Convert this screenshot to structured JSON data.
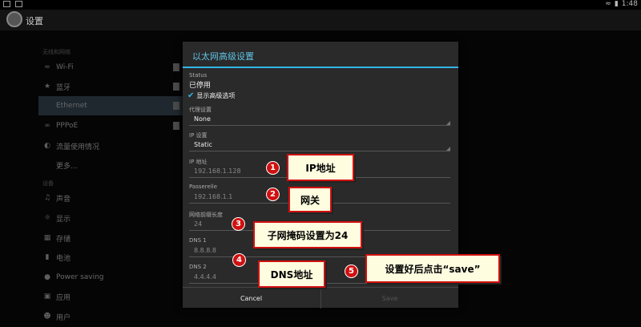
{
  "statusbar": {
    "time": "1:48"
  },
  "app": {
    "title": "设置"
  },
  "sidebar": {
    "categories": [
      "无线和网络",
      "设备"
    ],
    "items": [
      {
        "label": "Wi-Fi",
        "icon": "wifi-icon"
      },
      {
        "label": "蓝牙",
        "icon": "bluetooth-icon"
      },
      {
        "label": "Ethernet",
        "icon": "ethernet-icon"
      },
      {
        "label": "PPPoE",
        "icon": "pppoe-icon"
      },
      {
        "label": "流量使用情况",
        "icon": "data-usage-icon"
      },
      {
        "label": "更多..."
      },
      {
        "label": "声音",
        "icon": "sound-icon"
      },
      {
        "label": "显示",
        "icon": "display-icon"
      },
      {
        "label": "存储",
        "icon": "storage-icon"
      },
      {
        "label": "电池",
        "icon": "battery-icon"
      },
      {
        "label": "Power saving",
        "icon": "power-icon"
      },
      {
        "label": "应用",
        "icon": "apps-icon"
      },
      {
        "label": "用户",
        "icon": "user-icon"
      }
    ]
  },
  "dialog": {
    "title": "以太网高级设置",
    "status_label": "Status",
    "status_value": "已停用",
    "show_advanced": "显示高级选项",
    "proxy_label": "代理设置",
    "proxy_value": "None",
    "ip_settings_label": "IP 设置",
    "ip_settings_value": "Static",
    "ip_label": "IP 地址",
    "ip_value": "192.168.1.128",
    "gateway_label": "Passerelle",
    "gateway_value": "192.168.1.1",
    "prefix_label": "网络前缀长度",
    "prefix_value": "24",
    "dns1_label": "DNS 1",
    "dns1_value": "8.8.8.8",
    "dns2_label": "DNS 2",
    "dns2_value": "4.4.4.4",
    "cancel": "Cancel",
    "save": "Save"
  },
  "annotations": [
    {
      "num": "1",
      "text": "IP地址"
    },
    {
      "num": "2",
      "text": "网关"
    },
    {
      "num": "3",
      "text": "子网掩码设置为24"
    },
    {
      "num": "4",
      "text": "DNS地址"
    },
    {
      "num": "5",
      "text": "设置好后点击“save”"
    }
  ],
  "colors": {
    "accent": "#33b5e5",
    "callout_border": "#d01010",
    "selected_item": "#3a4a57"
  }
}
